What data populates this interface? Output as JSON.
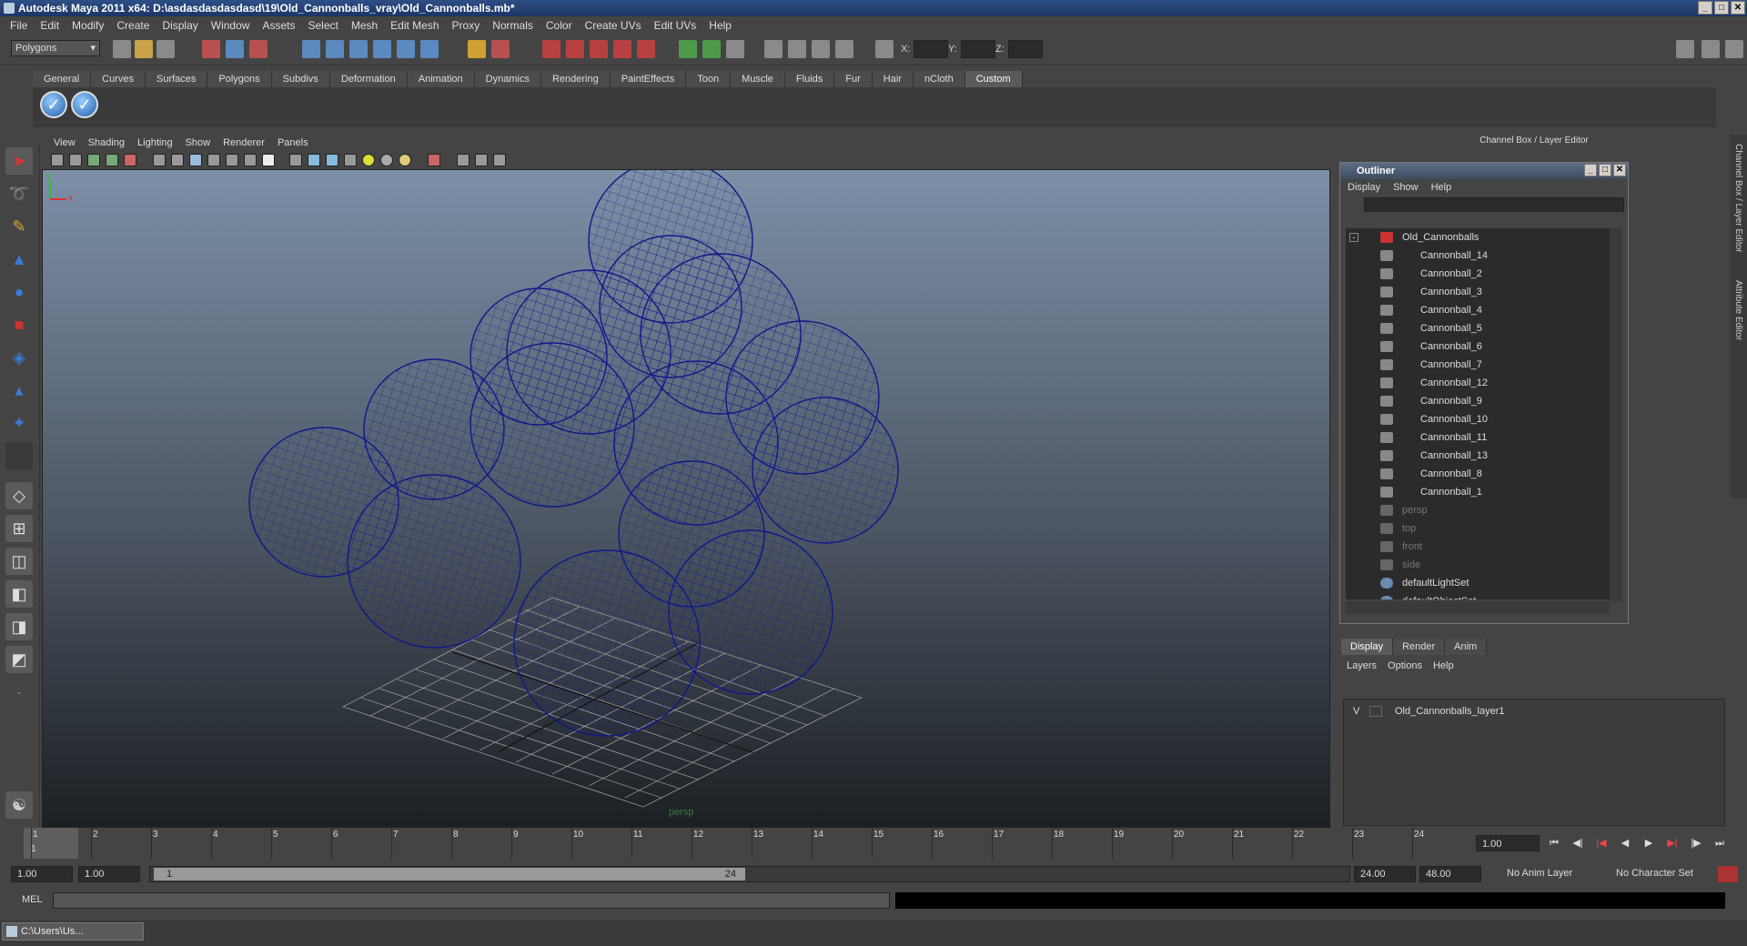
{
  "window": {
    "title": "Autodesk Maya 2011 x64: D:\\asdasdasdasdasd\\19\\Old_Cannonballs_vray\\Old_Cannonballs.mb*"
  },
  "menus": [
    "File",
    "Edit",
    "Modify",
    "Create",
    "Display",
    "Window",
    "Assets",
    "Select",
    "Mesh",
    "Edit Mesh",
    "Proxy",
    "Normals",
    "Color",
    "Create UVs",
    "Edit UVs",
    "Help"
  ],
  "status": {
    "mode": "Polygons",
    "x_label": "X:",
    "y_label": "Y:",
    "z_label": "Z:"
  },
  "shelf_tabs": [
    "General",
    "Curves",
    "Surfaces",
    "Polygons",
    "Subdivs",
    "Deformation",
    "Animation",
    "Dynamics",
    "Rendering",
    "PaintEffects",
    "Toon",
    "Muscle",
    "Fluids",
    "Fur",
    "Hair",
    "nCloth",
    "Custom"
  ],
  "viewport": {
    "menus": [
      "View",
      "Shading",
      "Lighting",
      "Show",
      "Renderer",
      "Panels"
    ],
    "camera": "persp",
    "axis_y": "y",
    "axis_x": "x"
  },
  "channel_box": {
    "header": "Channel Box / Layer Editor"
  },
  "outliner": {
    "title": "Outliner",
    "menus": [
      "Display",
      "Show",
      "Help"
    ],
    "items": [
      {
        "label": "Old_Cannonballs",
        "dim": false
      },
      {
        "label": "Cannonball_14",
        "dim": false
      },
      {
        "label": "Cannonball_2",
        "dim": false
      },
      {
        "label": "Cannonball_3",
        "dim": false
      },
      {
        "label": "Cannonball_4",
        "dim": false
      },
      {
        "label": "Cannonball_5",
        "dim": false
      },
      {
        "label": "Cannonball_6",
        "dim": false
      },
      {
        "label": "Cannonball_7",
        "dim": false
      },
      {
        "label": "Cannonball_12",
        "dim": false
      },
      {
        "label": "Cannonball_9",
        "dim": false
      },
      {
        "label": "Cannonball_10",
        "dim": false
      },
      {
        "label": "Cannonball_11",
        "dim": false
      },
      {
        "label": "Cannonball_13",
        "dim": false
      },
      {
        "label": "Cannonball_8",
        "dim": false
      },
      {
        "label": "Cannonball_1",
        "dim": false
      },
      {
        "label": "persp",
        "dim": true
      },
      {
        "label": "top",
        "dim": true
      },
      {
        "label": "front",
        "dim": true
      },
      {
        "label": "side",
        "dim": true
      },
      {
        "label": "defaultLightSet",
        "dim": false
      },
      {
        "label": "defaultObjectSet",
        "dim": false
      }
    ]
  },
  "layer_editor": {
    "tabs": [
      "Display",
      "Render",
      "Anim"
    ],
    "menus": [
      "Layers",
      "Options",
      "Help"
    ],
    "layer_visible": "V",
    "layer_name": "Old_Cannonballs_layer1"
  },
  "side_tabs": [
    "Channel Box / Layer Editor",
    "Attribute Editor"
  ],
  "timeline": {
    "frames": [
      "1",
      "2",
      "3",
      "4",
      "5",
      "6",
      "7",
      "8",
      "9",
      "10",
      "11",
      "12",
      "13",
      "14",
      "15",
      "16",
      "17",
      "18",
      "19",
      "20",
      "21",
      "22",
      "23",
      "24"
    ],
    "current_frame": "1",
    "current_field": "1.00"
  },
  "range": {
    "start": "1.00",
    "start2": "1.00",
    "slider_start": "1",
    "slider_end": "24",
    "end": "24.00",
    "end2": "48.00",
    "anim_layer": "No Anim Layer",
    "char_set": "No Character Set"
  },
  "command": {
    "label": "MEL"
  },
  "taskbar": {
    "item": "C:\\Users\\Us..."
  }
}
